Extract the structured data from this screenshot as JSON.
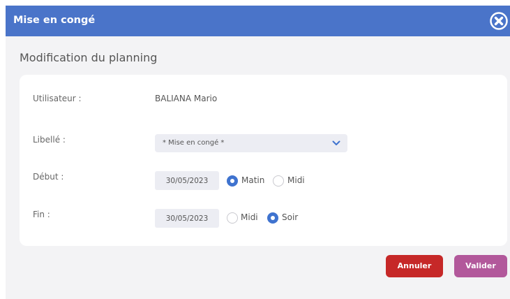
{
  "dialog": {
    "title": "Mise en congé",
    "subtitle": "Modification du planning"
  },
  "form": {
    "user_label": "Utilisateur :",
    "user_value": "BALIANA Mario",
    "libelle_label": "Libellé :",
    "libelle_value": "* Mise en congé *",
    "debut_label": "Début :",
    "debut_date": "30/05/2023",
    "debut_option1": "Matin",
    "debut_option2": "Midi",
    "debut_selected": "Matin",
    "fin_label": "Fin :",
    "fin_date": "30/05/2023",
    "fin_option1": "Midi",
    "fin_option2": "Soir",
    "fin_selected": "Soir"
  },
  "buttons": {
    "cancel": "Annuler",
    "ok": "Valider"
  },
  "colors": {
    "header": "#4a74c9",
    "radio_active": "#3f73cf",
    "cancel": "#c62828",
    "ok": "#b2589b"
  },
  "icons": {
    "close": "close-circle-icon",
    "dropdown": "chevron-down-icon"
  }
}
